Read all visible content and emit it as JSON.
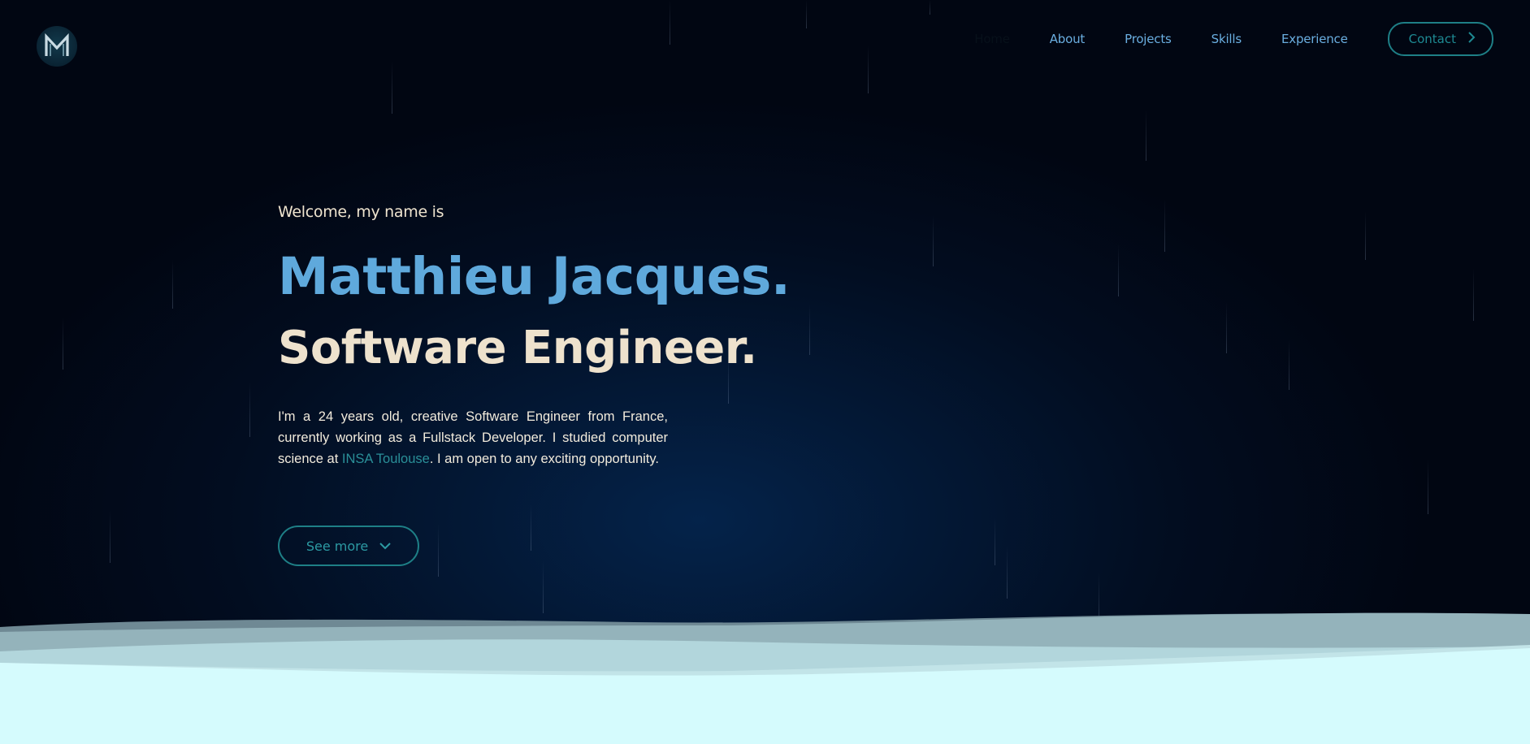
{
  "nav": {
    "logo_icon": "m-monogram-logo",
    "links": [
      {
        "label": "Home"
      },
      {
        "label": "About"
      },
      {
        "label": "Projects"
      },
      {
        "label": "Skills"
      },
      {
        "label": "Experience"
      }
    ],
    "contact_label": "Contact"
  },
  "hero": {
    "welcome": "Welcome, my name is",
    "name": "Matthieu Jacques.",
    "role": "Software Engineer.",
    "bio_before": "I'm a 24 years old, creative Software Engineer from France, currently working as a Fullstack Developer. I studied computer science at ",
    "bio_link": "INSA Toulouse",
    "bio_after": ". I am open to any exciting opportunity.",
    "see_more_label": "See more"
  },
  "colors": {
    "accent_blue": "#5fa9dc",
    "cream": "#eee2cd",
    "teal": "#1e7f86",
    "wave_light": "#d5fbfd"
  }
}
